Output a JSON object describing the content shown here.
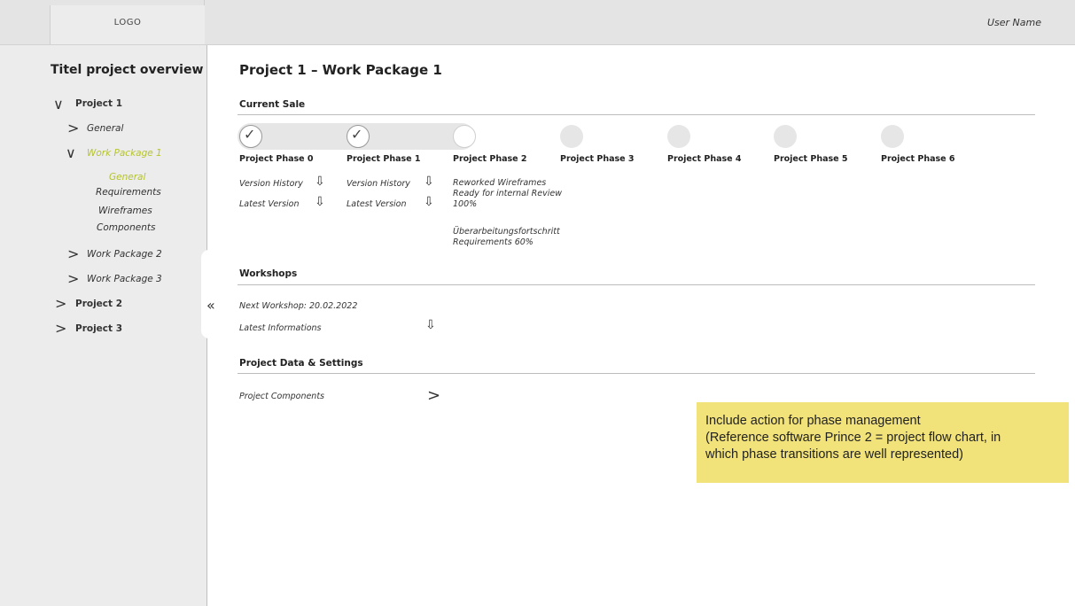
{
  "header": {
    "logo": "LOGO",
    "user_name": "User Name"
  },
  "sidebar": {
    "title": "Titel project overview",
    "tree": {
      "project1": "Project 1",
      "general": "General",
      "wp1": "Work Package 1",
      "wp1_children": [
        "General",
        "Requirements",
        "Wireframes",
        "Components"
      ],
      "wp2": "Work Package 2",
      "wp3": "Work Package 3",
      "project2": "Project 2",
      "project3": "Project 3"
    },
    "collapse_icon": "«"
  },
  "main": {
    "title": "Project 1 – Work Package 1",
    "current_state_label": "Current Sale",
    "phases": [
      {
        "label": "Project Phase 0",
        "status": "done"
      },
      {
        "label": "Project Phase 1",
        "status": "done"
      },
      {
        "label": "Project Phase 2",
        "status": "current"
      },
      {
        "label": "Project Phase 3",
        "status": "todo"
      },
      {
        "label": "Project Phase 4",
        "status": "todo"
      },
      {
        "label": "Project Phase 5",
        "status": "todo"
      },
      {
        "label": "Project Phase 6",
        "status": "todo"
      }
    ],
    "phase0_links": {
      "version_history": "Version History",
      "latest_version": "Latest Version"
    },
    "phase1_links": {
      "version_history": "Version History",
      "latest_version": "Latest Version"
    },
    "phase2_notes": {
      "line1": "Reworked Wireframes",
      "line2": "Ready for internal Review",
      "line3": "100%",
      "line4": "Überarbeitungsfortschritt",
      "line5": "Requirements 60%"
    },
    "workshops": {
      "title": "Workshops",
      "next": "Next Workshop: 20.02.2022",
      "latest": "Latest Informations"
    },
    "project_data": {
      "title": "Project Data & Settings",
      "components": "Project Components"
    }
  },
  "note": {
    "line1": "Include action for phase management",
    "line2": "(Reference software Prince 2 = project flow chart, in",
    "line3": "which phase transitions are well represented)"
  },
  "colors": {
    "accent": "#b6c42c",
    "sticky": "#f1e27a",
    "sidebar_bg": "#ececec"
  }
}
